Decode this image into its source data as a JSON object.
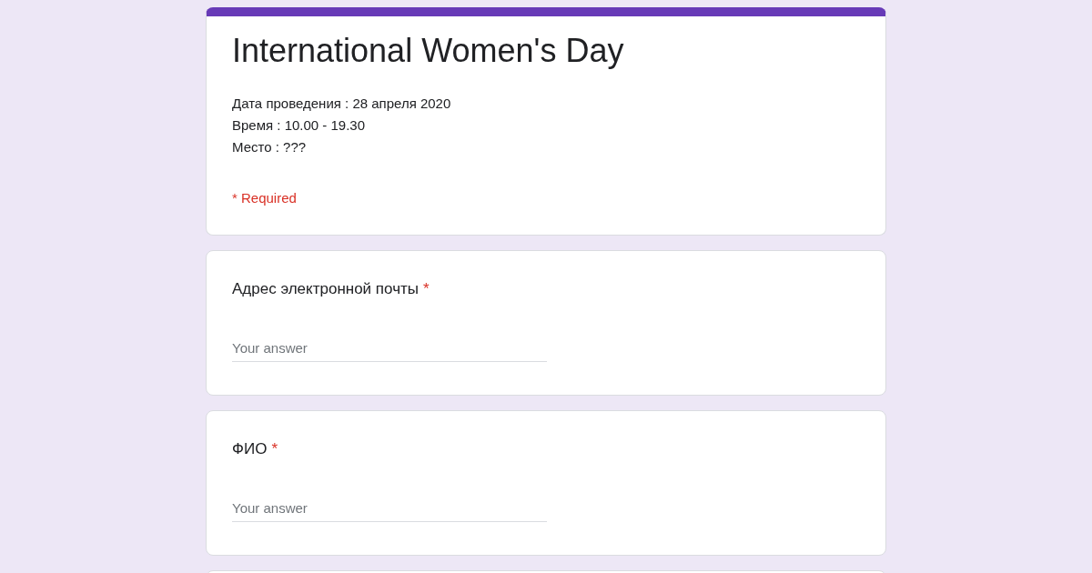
{
  "form": {
    "title": "International Women's Day",
    "description": [
      "Дата проведения : 28 апреля 2020",
      "Время : 10.00 - 19.30",
      "Место : ???"
    ],
    "required_note": "* Required"
  },
  "questions": [
    {
      "label": "Адрес электронной почты",
      "required_mark": "*",
      "placeholder": "Your answer"
    },
    {
      "label": "ФИО",
      "required_mark": "*",
      "placeholder": "Your answer"
    }
  ]
}
